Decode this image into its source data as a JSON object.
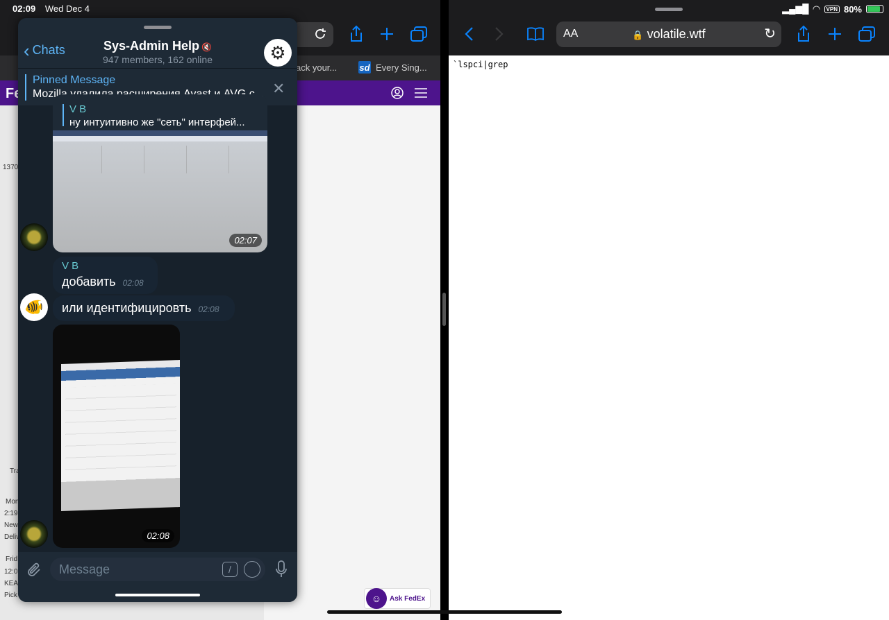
{
  "status": {
    "time": "02:09",
    "date": "Wed Dec 4",
    "battery": "80%",
    "vpn": "VPN"
  },
  "left_safari": {
    "tabs": [
      {
        "title": "ack your..."
      },
      {
        "title": "Every Sing..."
      }
    ],
    "tab2_logo": "sd",
    "fedex_logo": "Fe",
    "side_fragments": [
      "1370",
      "Tra",
      "Mon",
      "2:19",
      "New",
      "Deliv",
      "Frid",
      "12:0",
      "KEA",
      "Pick"
    ],
    "ask_fedex": "Ask FedEx"
  },
  "telegram": {
    "back_label": "Chats",
    "title": "Sys-Admin Help",
    "subtitle": "947 members, 162 online",
    "pinned": {
      "title": "Pinned Message",
      "text": "Mozilla удалила расширения Avast и AVG с..."
    },
    "messages": [
      {
        "type": "media-reply",
        "reply_name": "V B",
        "reply_text": "ну интуитивно же \"сеть\"  интерфей...",
        "time": "02:07"
      },
      {
        "type": "text",
        "name": "V B",
        "text": "добавить",
        "time": "02:08"
      },
      {
        "type": "text",
        "text": "или идентифицировть",
        "time": "02:08"
      },
      {
        "type": "media",
        "time": "02:08"
      }
    ],
    "input_placeholder": "Message"
  },
  "right_safari": {
    "aa_label": "AA",
    "url": "volatile.wtf",
    "page_text": "`lspci|grep"
  },
  "colors": {
    "telegram_bg": "#17212b",
    "accent": "#5eb5f7",
    "fedex_purple": "#4d148c",
    "safari_blue": "#0a84ff"
  }
}
